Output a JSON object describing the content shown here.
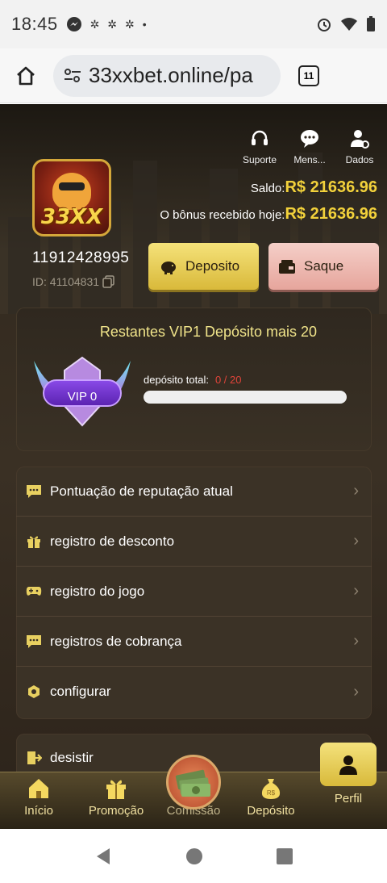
{
  "status_bar": {
    "time": "18:45"
  },
  "browser": {
    "url": "33xxbet.online/pa",
    "tab_count": "11"
  },
  "header": {
    "quick_links": [
      {
        "label": "Suporte",
        "icon": "headset-icon"
      },
      {
        "label": "Mens...",
        "icon": "chat-icon"
      },
      {
        "label": "Dados",
        "icon": "user-settings-icon"
      }
    ],
    "avatar_logo": "33XX",
    "saldo_label": "Saldo:",
    "saldo_value": "R$ 21636.96",
    "bonus_label": "O bônus recebido hoje:",
    "bonus_value": "R$ 21636.96",
    "phone": "11912428995",
    "user_id": "ID: 41104831"
  },
  "actions": {
    "deposit_label": "Deposito",
    "withdraw_label": "Saque"
  },
  "vip": {
    "title": "Restantes VIP1 Depósito mais 20",
    "badge_label": "VIP 0",
    "deposit_total_label": "depósito total:",
    "deposit_total_value": "0 / 20",
    "progress": 0
  },
  "menu": {
    "items": [
      {
        "label": "Pontuação de reputação atual",
        "icon": "message-icon"
      },
      {
        "label": "registro de desconto",
        "icon": "gift-icon"
      },
      {
        "label": "registro do jogo",
        "icon": "gamepad-icon"
      },
      {
        "label": "registros de cobrança",
        "icon": "message-icon"
      },
      {
        "label": "configurar",
        "icon": "hexagon-icon"
      }
    ],
    "logout_label": "desistir"
  },
  "bottom_nav": {
    "items": [
      {
        "label": "Início",
        "icon": "home-icon"
      },
      {
        "label": "Promoção",
        "icon": "gift-icon"
      },
      {
        "label": "Comissão",
        "icon": "money-icon"
      },
      {
        "label": "Depósito",
        "icon": "money-bag-icon"
      },
      {
        "label": "Perfil",
        "icon": "user-icon"
      }
    ]
  },
  "colors": {
    "accent_gold": "#f2d13b",
    "background": "#2e261c",
    "error_red": "#e0443a"
  }
}
